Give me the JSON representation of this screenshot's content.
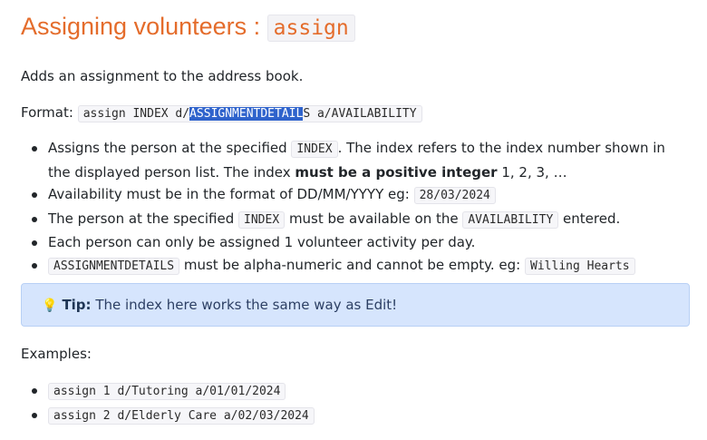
{
  "heading": {
    "text": "Assigning volunteers : ",
    "code": "assign"
  },
  "intro": "Adds an assignment to the address book.",
  "format": {
    "label": "Format: ",
    "code_before": "assign INDEX d/",
    "code_highlight": "ASSIGNMENTDETAIL",
    "code_after": "S a/AVAILABILITY"
  },
  "notes": {
    "n1": {
      "a": "Assigns the person at the specified ",
      "code": "INDEX",
      "b": ". The index refers to the index number shown in the displayed person list. The index ",
      "bold": "must be a positive integer",
      "c": " 1, 2, 3, …"
    },
    "n2": {
      "a": "Availability must be in the format of DD/MM/YYYY eg: ",
      "code": "28/03/2024"
    },
    "n3": {
      "a": "The person at the specified ",
      "code1": "INDEX",
      "b": " must be available on the ",
      "code2": "AVAILABILITY",
      "c": " entered."
    },
    "n4": {
      "a": "Each person can only be assigned 1 volunteer activity per day."
    },
    "n5": {
      "code1": "ASSIGNMENTDETAILS",
      "a": " must be alpha-numeric and cannot be empty. eg: ",
      "code2": "Willing Hearts"
    }
  },
  "tip": {
    "icon": "lightbulb-icon",
    "label": "Tip:",
    "text": " The index here works the same way as Edit!"
  },
  "examples": {
    "label": "Examples:",
    "items": [
      "assign 1 d/Tutoring a/01/01/2024",
      "assign 2 d/Elderly Care a/02/03/2024"
    ]
  },
  "colors": {
    "heading": "#e46c2b",
    "tip_background": "#d6e5fd",
    "selection": "#2f63cc"
  }
}
